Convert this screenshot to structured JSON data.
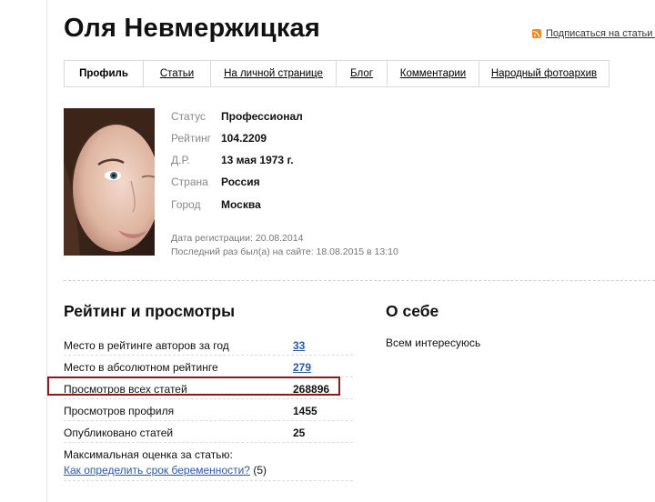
{
  "profile": {
    "name": "Оля Невмержицкая",
    "subscribe_link": "Подписаться на статьи а"
  },
  "tabs": [
    {
      "label": "Профиль",
      "active": true
    },
    {
      "label": "Статьи"
    },
    {
      "label": "На личной странице"
    },
    {
      "label": "Блог"
    },
    {
      "label": "Комментарии"
    },
    {
      "label": "Народный фотоархив"
    }
  ],
  "info": [
    {
      "label": "Статус",
      "value": "Профессионал"
    },
    {
      "label": "Рейтинг",
      "value": "104.2209"
    },
    {
      "label": "Д.Р.",
      "value": "13 мая 1973 г."
    },
    {
      "label": "Страна",
      "value": "Россия"
    },
    {
      "label": "Город",
      "value": "Москва"
    }
  ],
  "meta": {
    "registration": "Дата регистрации: 20.08.2014",
    "last_seen": "Последний раз был(а) на сайте: 18.08.2015 в 13:10"
  },
  "ratings": {
    "title": "Рейтинг и просмотры",
    "rows": [
      {
        "label": "Место в рейтинге авторов за год",
        "value": "33"
      },
      {
        "label": "Место в абсолютном рейтинге",
        "value": "279"
      },
      {
        "label": "Просмотров всех статей",
        "value": "268896"
      },
      {
        "label": "Просмотров профиля",
        "value": "1455"
      },
      {
        "label": "Опубликовано статей",
        "value": "25"
      }
    ],
    "max_label": "Максимальная оценка за статью:",
    "max_article": "Как определить срок беременности?",
    "max_score": "(5)"
  },
  "about": {
    "title": "О себе",
    "text": "Всем интересуюсь"
  },
  "colors": {
    "link": "#2a5aa0",
    "highlight_border": "#8b1a1a",
    "rss": "#f08a24"
  }
}
